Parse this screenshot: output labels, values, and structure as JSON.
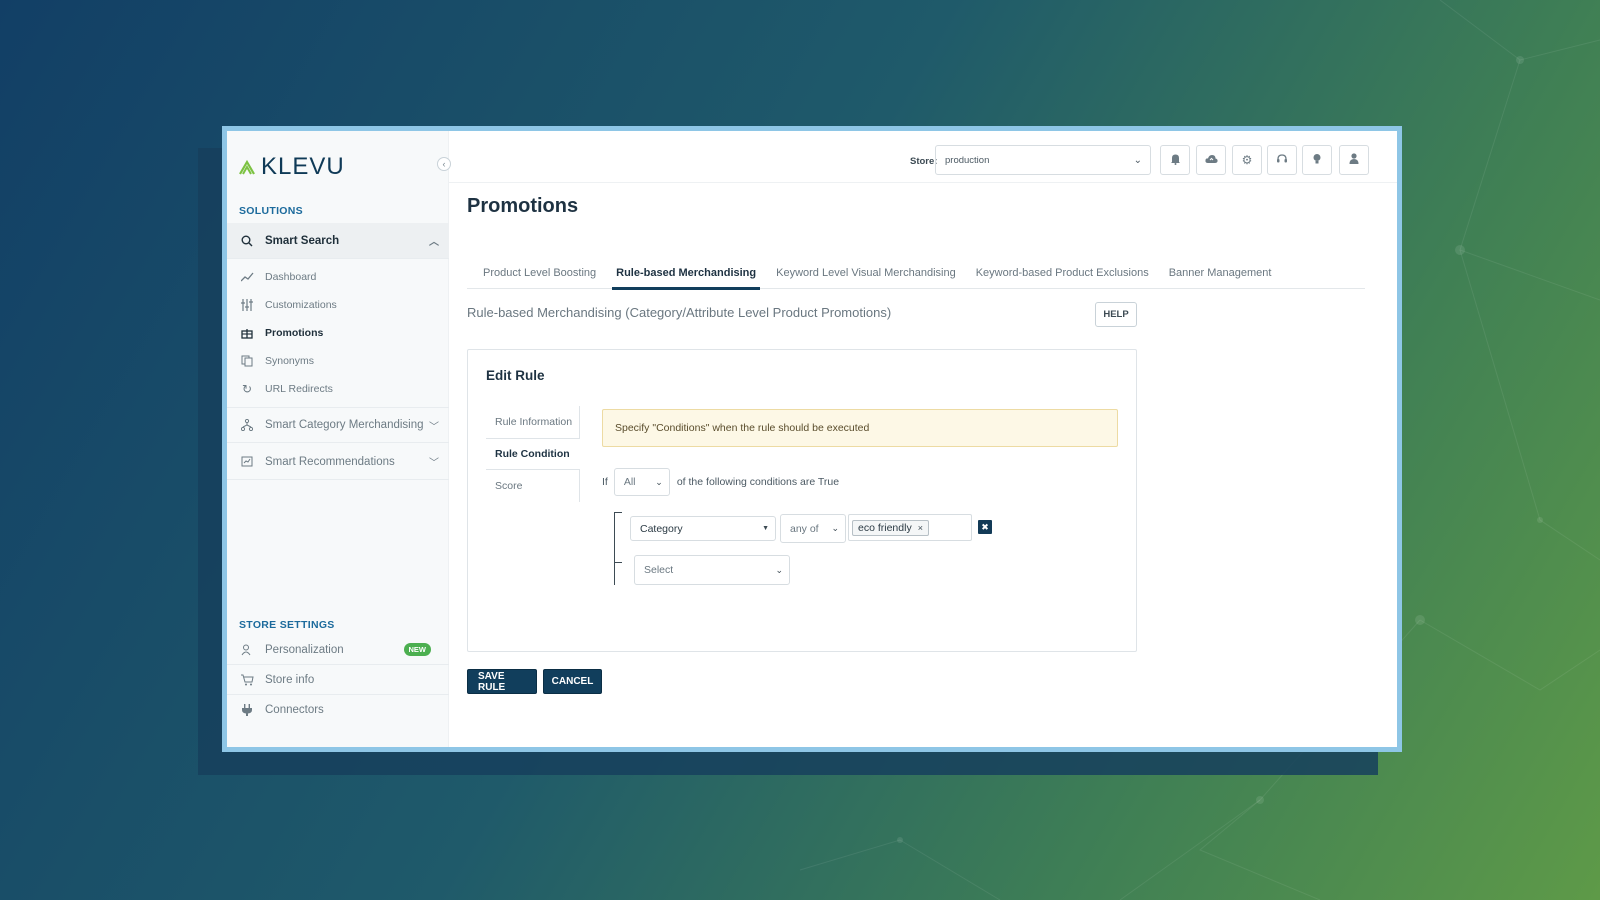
{
  "app": {
    "logo_text": "KLEVU"
  },
  "sidebar": {
    "solutions_title": "SOLUTIONS",
    "smart_search": "Smart Search",
    "items": [
      {
        "label": "Dashboard",
        "icon": "trend-icon"
      },
      {
        "label": "Customizations",
        "icon": "sliders-icon"
      },
      {
        "label": "Promotions",
        "icon": "gift-icon"
      },
      {
        "label": "Synonyms",
        "icon": "copy-icon"
      },
      {
        "label": "URL Redirects",
        "icon": "refresh-icon"
      }
    ],
    "smart_category": "Smart Category Merchandising",
    "smart_recs": "Smart Recommendations",
    "store_settings_title": "STORE SETTINGS",
    "settings": [
      {
        "label": "Personalization",
        "icon": "user-icon"
      },
      {
        "label": "Store info",
        "icon": "cart-icon"
      },
      {
        "label": "Connectors",
        "icon": "plug-icon"
      }
    ],
    "new_badge": "NEW"
  },
  "topbar": {
    "store_label": "Store:",
    "store_value": "production"
  },
  "page": {
    "title": "Promotions",
    "tabs": [
      "Product Level Boosting",
      "Rule-based Merchandising",
      "Keyword Level Visual Merchandising",
      "Keyword-based Product Exclusions",
      "Banner Management"
    ],
    "subheading": "Rule-based Merchandising (Category/Attribute Level Product Promotions)",
    "help": "HELP"
  },
  "editor": {
    "title": "Edit Rule",
    "side_tabs": [
      "Rule Information",
      "Rule Condition",
      "Score"
    ],
    "note": "Specify \"Conditions\" when the rule should be executed",
    "if_label": "If",
    "match_value": "All",
    "cond_text": "of the following conditions are True",
    "field_value": "Category",
    "operator_value": "any of",
    "tag_value": "eco friendly",
    "tag_remove": "×",
    "delete_icon": "✖",
    "select_placeholder": "Select"
  },
  "actions": {
    "save": "SAVE RULE",
    "cancel": "CANCEL"
  },
  "colors": {
    "brand": "#113e5c",
    "accent": "#1b6a9c",
    "badge": "#4caf50"
  }
}
